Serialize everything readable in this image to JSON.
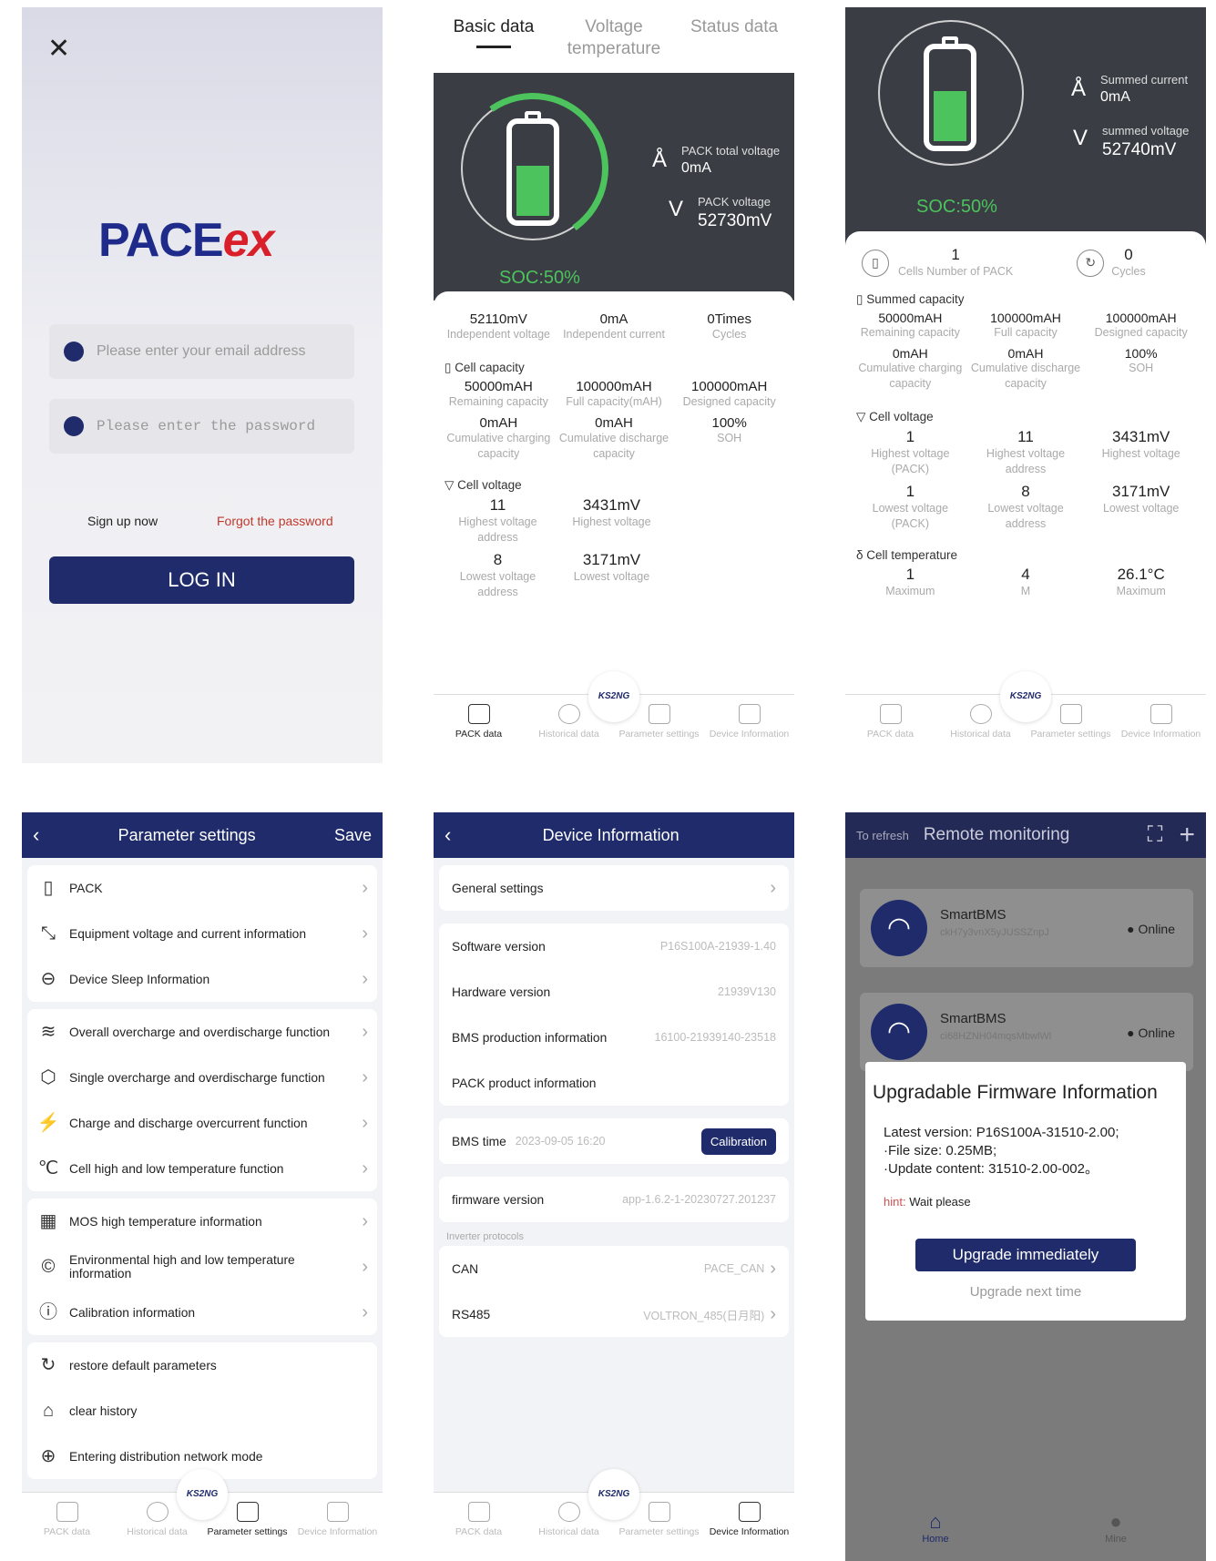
{
  "login": {
    "close_icon": "close-icon",
    "logo_a": "PACE",
    "logo_b": "ex",
    "email_placeholder": "Please enter your email address",
    "password_placeholder": "Please enter the password",
    "signup": "Sign up now",
    "forgot": "Forgot the password",
    "login_btn": "LOG IN"
  },
  "pack": {
    "tabs": [
      "Basic data",
      "Voltage temperature",
      "Status data"
    ],
    "total_voltage_label": "PACK total voltage",
    "total_current": "0mA",
    "pack_voltage_label": "PACK voltage",
    "pack_voltage": "52730mV",
    "soc": "SOC:50%",
    "stats": [
      {
        "v": "52110mV",
        "l": "Independent voltage"
      },
      {
        "v": "0mA",
        "l": "Independent current"
      },
      {
        "v": "0Times",
        "l": "Cycles"
      }
    ],
    "cell_capacity_title": "Cell capacity",
    "capacity": [
      {
        "v": "50000mAH",
        "l": "Remaining capacity"
      },
      {
        "v": "100000mAH",
        "l": "Full capacity(mAH)"
      },
      {
        "v": "100000mAH",
        "l": "Designed capacity"
      },
      {
        "v": "0mAH",
        "l": "Cumulative charging capacity"
      },
      {
        "v": "0mAH",
        "l": "Cumulative discharge capacity"
      },
      {
        "v": "100%",
        "l": "SOH"
      }
    ],
    "cell_voltage_title": "Cell voltage",
    "voltage": [
      {
        "v": "11",
        "l": "Highest voltage address"
      },
      {
        "v": "3431mV",
        "l": "Highest voltage"
      },
      {
        "v": "8",
        "l": "Lowest voltage address"
      },
      {
        "v": "3171mV",
        "l": "Lowest voltage"
      }
    ]
  },
  "nav": {
    "items": [
      "PACK data",
      "Historical data",
      "Parameter settings",
      "Device Information"
    ],
    "badge": "KS2NG"
  },
  "summary": {
    "summed_current_label": "Summed current",
    "summed_current": "0mA",
    "summed_voltage_label": "summed voltage",
    "summed_voltage": "52740mV",
    "soc": "SOC:50%",
    "cells_number": "1",
    "cells_label": "Cells Number of PACK",
    "cycles": "0",
    "cycles_label": "Cycles",
    "summed_capacity_title": "Summed capacity",
    "capacity": [
      {
        "v": "50000mAH",
        "l": "Remaining capacity"
      },
      {
        "v": "100000mAH",
        "l": "Full capacity"
      },
      {
        "v": "100000mAH",
        "l": "Designed capacity"
      },
      {
        "v": "0mAH",
        "l": "Cumulative charging capacity"
      },
      {
        "v": "0mAH",
        "l": "Cumulative discharge capacity"
      },
      {
        "v": "100%",
        "l": "SOH"
      }
    ],
    "cell_voltage_title": "Cell voltage",
    "voltage": [
      {
        "v": "1",
        "l": "Highest voltage (PACK)"
      },
      {
        "v": "11",
        "l": "Highest voltage address"
      },
      {
        "v": "3431mV",
        "l": "Highest voltage"
      },
      {
        "v": "1",
        "l": "Lowest voltage (PACK)"
      },
      {
        "v": "8",
        "l": "Lowest voltage address"
      },
      {
        "v": "3171mV",
        "l": "Lowest voltage"
      }
    ],
    "cell_temp_title": "Cell temperature",
    "temp": [
      {
        "v": "1",
        "l": "Maximum"
      },
      {
        "v": "4",
        "l": "M"
      },
      {
        "v": "26.1°C",
        "l": "Maximum"
      }
    ]
  },
  "params": {
    "title": "Parameter settings",
    "save": "Save",
    "groups": [
      [
        "PACK",
        "Equipment voltage and current information",
        "Device Sleep Information"
      ],
      [
        "Overall overcharge and overdischarge function",
        "Single overcharge and overdischarge function",
        "Charge and discharge overcurrent function",
        "Cell high and low temperature function"
      ],
      [
        "MOS high temperature information",
        "Environmental high and low temperature information",
        "Calibration information"
      ],
      [
        "restore default parameters",
        "clear history",
        "Entering distribution network mode"
      ]
    ]
  },
  "device": {
    "title": "Device Information",
    "general": "General settings",
    "software_label": "Software version",
    "software": "P16S100A-21939-1.40",
    "hardware_label": "Hardware version",
    "hardware": "21939V130",
    "bms_prod_label": "BMS production information",
    "bms_prod": "16100-21939140-23518",
    "pack_prod_label": "PACK product information",
    "bms_time_label": "BMS time",
    "bms_time": "2023-09-05 16:20",
    "calibration": "Calibration",
    "firmware_label": "firmware version",
    "firmware": "app-1.6.2-1-20230727.201237",
    "inverter_title": "Inverter protocols",
    "can_label": "CAN",
    "can": "PACE_CAN",
    "rs485_label": "RS485",
    "rs485": "VOLTRON_485(日月阳)"
  },
  "remote": {
    "refresh": "To refresh",
    "title": "Remote monitoring",
    "devices": [
      {
        "name": "SmartBMS",
        "id": "ckH7y3vnX5yJUSSZnpJ",
        "status": "Online"
      },
      {
        "name": "SmartBMS",
        "id": "ci68HZNH04mqsMbwlWl",
        "status": "Online"
      }
    ],
    "modal_title": "Upgradable Firmware Information",
    "latest": "Latest version:  P16S100A-31510-2.00;",
    "size": "·File size:  0.25MB;",
    "content": "·Update content:  31510-2.00-002。",
    "hint_label": "hint:",
    "hint": "Wait please",
    "upgrade_btn": "Upgrade immediately",
    "later": "Upgrade next time",
    "home": "Home",
    "mine": "Mine"
  },
  "colors": {
    "navy": "#1f2b6b",
    "green": "#4cc35c",
    "red": "#d81f2a"
  }
}
